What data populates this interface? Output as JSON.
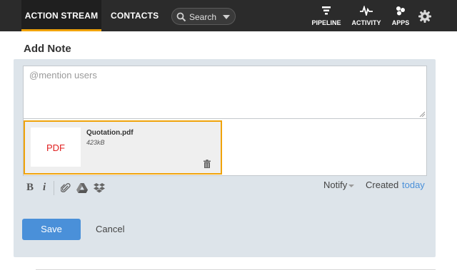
{
  "nav": {
    "tabs": [
      {
        "label": "ACTION STREAM",
        "active": true
      },
      {
        "label": "CONTACTS",
        "active": false
      }
    ],
    "search": {
      "placeholder": "Search"
    },
    "right_items": [
      {
        "label": "PIPELINE",
        "icon": "pipeline-icon"
      },
      {
        "label": "ACTIVITY",
        "icon": "activity-icon"
      },
      {
        "label": "APPS",
        "icon": "apps-icon"
      }
    ],
    "settings_icon": "gear-icon"
  },
  "note": {
    "heading": "Add Note",
    "editor_placeholder": "@mention users",
    "attachment": {
      "thumb_label": "PDF",
      "file_name": "Quotation.pdf",
      "file_size": "423kB"
    },
    "toolbar": {
      "bold_label": "B",
      "italic_label": "i"
    },
    "notify_label": "Notify",
    "created_label": "Created",
    "created_value": "today",
    "save_label": "Save",
    "cancel_label": "Cancel"
  },
  "colors": {
    "accent": "#f0a30a",
    "primary": "#4a90d9",
    "topbar": "#2b2b2b",
    "panel": "#dde4ea",
    "pdf_red": "#e02020"
  }
}
